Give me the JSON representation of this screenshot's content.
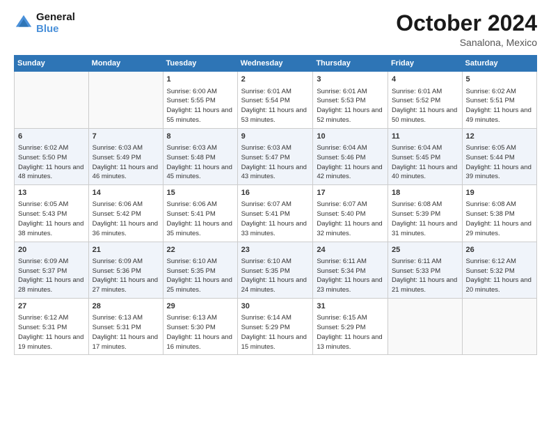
{
  "logo": {
    "line1": "General",
    "line2": "Blue"
  },
  "header": {
    "month": "October 2024",
    "location": "Sanalona, Mexico"
  },
  "weekdays": [
    "Sunday",
    "Monday",
    "Tuesday",
    "Wednesday",
    "Thursday",
    "Friday",
    "Saturday"
  ],
  "weeks": [
    [
      {
        "day": "",
        "info": ""
      },
      {
        "day": "",
        "info": ""
      },
      {
        "day": "1",
        "info": "Sunrise: 6:00 AM\nSunset: 5:55 PM\nDaylight: 11 hours and 55 minutes."
      },
      {
        "day": "2",
        "info": "Sunrise: 6:01 AM\nSunset: 5:54 PM\nDaylight: 11 hours and 53 minutes."
      },
      {
        "day": "3",
        "info": "Sunrise: 6:01 AM\nSunset: 5:53 PM\nDaylight: 11 hours and 52 minutes."
      },
      {
        "day": "4",
        "info": "Sunrise: 6:01 AM\nSunset: 5:52 PM\nDaylight: 11 hours and 50 minutes."
      },
      {
        "day": "5",
        "info": "Sunrise: 6:02 AM\nSunset: 5:51 PM\nDaylight: 11 hours and 49 minutes."
      }
    ],
    [
      {
        "day": "6",
        "info": "Sunrise: 6:02 AM\nSunset: 5:50 PM\nDaylight: 11 hours and 48 minutes."
      },
      {
        "day": "7",
        "info": "Sunrise: 6:03 AM\nSunset: 5:49 PM\nDaylight: 11 hours and 46 minutes."
      },
      {
        "day": "8",
        "info": "Sunrise: 6:03 AM\nSunset: 5:48 PM\nDaylight: 11 hours and 45 minutes."
      },
      {
        "day": "9",
        "info": "Sunrise: 6:03 AM\nSunset: 5:47 PM\nDaylight: 11 hours and 43 minutes."
      },
      {
        "day": "10",
        "info": "Sunrise: 6:04 AM\nSunset: 5:46 PM\nDaylight: 11 hours and 42 minutes."
      },
      {
        "day": "11",
        "info": "Sunrise: 6:04 AM\nSunset: 5:45 PM\nDaylight: 11 hours and 40 minutes."
      },
      {
        "day": "12",
        "info": "Sunrise: 6:05 AM\nSunset: 5:44 PM\nDaylight: 11 hours and 39 minutes."
      }
    ],
    [
      {
        "day": "13",
        "info": "Sunrise: 6:05 AM\nSunset: 5:43 PM\nDaylight: 11 hours and 38 minutes."
      },
      {
        "day": "14",
        "info": "Sunrise: 6:06 AM\nSunset: 5:42 PM\nDaylight: 11 hours and 36 minutes."
      },
      {
        "day": "15",
        "info": "Sunrise: 6:06 AM\nSunset: 5:41 PM\nDaylight: 11 hours and 35 minutes."
      },
      {
        "day": "16",
        "info": "Sunrise: 6:07 AM\nSunset: 5:41 PM\nDaylight: 11 hours and 33 minutes."
      },
      {
        "day": "17",
        "info": "Sunrise: 6:07 AM\nSunset: 5:40 PM\nDaylight: 11 hours and 32 minutes."
      },
      {
        "day": "18",
        "info": "Sunrise: 6:08 AM\nSunset: 5:39 PM\nDaylight: 11 hours and 31 minutes."
      },
      {
        "day": "19",
        "info": "Sunrise: 6:08 AM\nSunset: 5:38 PM\nDaylight: 11 hours and 29 minutes."
      }
    ],
    [
      {
        "day": "20",
        "info": "Sunrise: 6:09 AM\nSunset: 5:37 PM\nDaylight: 11 hours and 28 minutes."
      },
      {
        "day": "21",
        "info": "Sunrise: 6:09 AM\nSunset: 5:36 PM\nDaylight: 11 hours and 27 minutes."
      },
      {
        "day": "22",
        "info": "Sunrise: 6:10 AM\nSunset: 5:35 PM\nDaylight: 11 hours and 25 minutes."
      },
      {
        "day": "23",
        "info": "Sunrise: 6:10 AM\nSunset: 5:35 PM\nDaylight: 11 hours and 24 minutes."
      },
      {
        "day": "24",
        "info": "Sunrise: 6:11 AM\nSunset: 5:34 PM\nDaylight: 11 hours and 23 minutes."
      },
      {
        "day": "25",
        "info": "Sunrise: 6:11 AM\nSunset: 5:33 PM\nDaylight: 11 hours and 21 minutes."
      },
      {
        "day": "26",
        "info": "Sunrise: 6:12 AM\nSunset: 5:32 PM\nDaylight: 11 hours and 20 minutes."
      }
    ],
    [
      {
        "day": "27",
        "info": "Sunrise: 6:12 AM\nSunset: 5:31 PM\nDaylight: 11 hours and 19 minutes."
      },
      {
        "day": "28",
        "info": "Sunrise: 6:13 AM\nSunset: 5:31 PM\nDaylight: 11 hours and 17 minutes."
      },
      {
        "day": "29",
        "info": "Sunrise: 6:13 AM\nSunset: 5:30 PM\nDaylight: 11 hours and 16 minutes."
      },
      {
        "day": "30",
        "info": "Sunrise: 6:14 AM\nSunset: 5:29 PM\nDaylight: 11 hours and 15 minutes."
      },
      {
        "day": "31",
        "info": "Sunrise: 6:15 AM\nSunset: 5:29 PM\nDaylight: 11 hours and 13 minutes."
      },
      {
        "day": "",
        "info": ""
      },
      {
        "day": "",
        "info": ""
      }
    ]
  ]
}
